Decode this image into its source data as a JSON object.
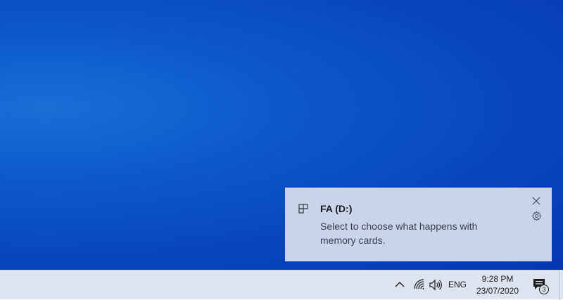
{
  "toast": {
    "title": "FA (D:)",
    "body": "Select to choose what happens with memory cards.",
    "app_icon": "removable-drive-icon",
    "close_icon": "close-icon",
    "settings_icon": "gear-icon"
  },
  "taskbar": {
    "tray": {
      "chevron_icon": "chevron-up-icon",
      "network_icon": "wifi-icon",
      "volume_icon": "speaker-icon",
      "language": "ENG",
      "time": "9:28 PM",
      "date": "23/07/2020",
      "action_center_icon": "notification-icon",
      "notification_count": "3"
    }
  },
  "colors": {
    "desktop_blue": "#0846bf",
    "toast_bg": "#c9d4ea",
    "taskbar_bg": "#dde3ef"
  }
}
